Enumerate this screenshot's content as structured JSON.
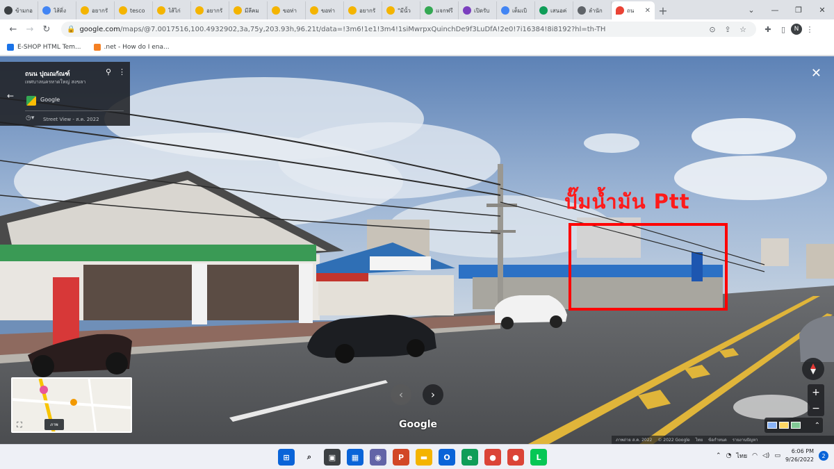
{
  "browser": {
    "tabs": [
      {
        "favicon": "wikipedia-icon",
        "title": "ข้ามกอ",
        "color": "#3c4043"
      },
      {
        "favicon": "google-icon",
        "title": "ไส้ติ่ง",
        "color": "#4285f4"
      },
      {
        "favicon": "emoji-icon",
        "title": "อยากรั",
        "color": "#f4b400"
      },
      {
        "favicon": "emoji-icon",
        "title": "tesco",
        "color": "#f4b400"
      },
      {
        "favicon": "emoji-icon",
        "title": "ไส้ไก่",
        "color": "#f4b400"
      },
      {
        "favicon": "emoji-icon",
        "title": "อยากรั",
        "color": "#f4b400"
      },
      {
        "favicon": "emoji-icon",
        "title": "มีลีคม",
        "color": "#f4b400"
      },
      {
        "favicon": "emoji-icon",
        "title": "ขอท่า",
        "color": "#f4b400"
      },
      {
        "favicon": "emoji-icon",
        "title": "ขอท่า",
        "color": "#f4b400"
      },
      {
        "favicon": "emoji-icon",
        "title": "อยากรั",
        "color": "#f4b400"
      },
      {
        "favicon": "emoji-icon",
        "title": "\"มีนั้ว",
        "color": "#f4b400"
      },
      {
        "favicon": "check-icon",
        "title": "แจกฟรี",
        "color": "#34a853"
      },
      {
        "favicon": "purple-app-icon",
        "title": "เปิดรับ",
        "color": "#7b3fbf"
      },
      {
        "favicon": "google-icon",
        "title": "เต็มเบิ",
        "color": "#4285f4"
      },
      {
        "favicon": "green-app-icon",
        "title": "เสนอค่",
        "color": "#0f9d58"
      },
      {
        "favicon": "globe-icon",
        "title": "ลำนัก",
        "color": "#5f6368"
      }
    ],
    "active_tab": {
      "favicon": "maps-pin-icon",
      "title": "ถน",
      "close": "✕"
    },
    "new_tab": "+",
    "window_controls": [
      "⌄",
      "—",
      "❐",
      "✕"
    ],
    "url_host": "google.com",
    "url_path": "/maps/@7.0017516,100.4932902,3a,75y,203.93h,96.21t/data=!3m6!1e1!3m4!1siMwrpxQuinchDe9f3LuDfA!2e0!7i16384!8i8192?hl=th-TH",
    "profile_initial": "N",
    "bookmarks": [
      {
        "label": "E-SHOP HTML Tem...",
        "color": "#1a73e8"
      },
      {
        "label": ".net - How do I ena...",
        "color": "#f48024"
      }
    ]
  },
  "streetview": {
    "place_title": "ถนน ปุณณกัณฑ์",
    "place_sub": "เทศบาลนครหาดใหญ่ สงขลา",
    "provider": "Google",
    "capture_date": "Street View - ส.ค. 2022",
    "annotation": "ปั๊มน้ำมัน Ptt",
    "watermark": "Google",
    "minimap_label": "ภาพ",
    "footer": [
      "ภาพถ่าย ส.ค. 2022",
      "© 2022 Google",
      "ไทย",
      "ข้อกำหนด",
      "รายงานปัญหา"
    ]
  },
  "taskbar": {
    "lang": "ไทย",
    "time": "6:06 PM",
    "date": "9/26/2022",
    "notifications": "2",
    "apps": [
      {
        "name": "windows-start-icon",
        "color": "#0a64d8",
        "glyph": "⊞"
      },
      {
        "name": "search-icon",
        "color": "#eef0f6",
        "glyph": "⌕"
      },
      {
        "name": "task-view-icon",
        "color": "#3c4043",
        "glyph": "▣"
      },
      {
        "name": "widgets-icon",
        "color": "#0a64d8",
        "glyph": "▦"
      },
      {
        "name": "chat-icon",
        "color": "#6264a7",
        "glyph": "◉"
      },
      {
        "name": "powerpoint-icon",
        "color": "#d24726",
        "glyph": "P"
      },
      {
        "name": "file-explorer-icon",
        "color": "#f4b400",
        "glyph": "▬"
      },
      {
        "name": "outlook-icon",
        "color": "#0a64d8",
        "glyph": "O"
      },
      {
        "name": "edge-icon",
        "color": "#0f9d58",
        "glyph": "e"
      },
      {
        "name": "chrome-icon",
        "color": "#db4437",
        "glyph": "●"
      },
      {
        "name": "chrome-profile-icon",
        "color": "#db4437",
        "glyph": "●"
      },
      {
        "name": "line-app-icon",
        "color": "#06c755",
        "glyph": "L"
      }
    ]
  }
}
